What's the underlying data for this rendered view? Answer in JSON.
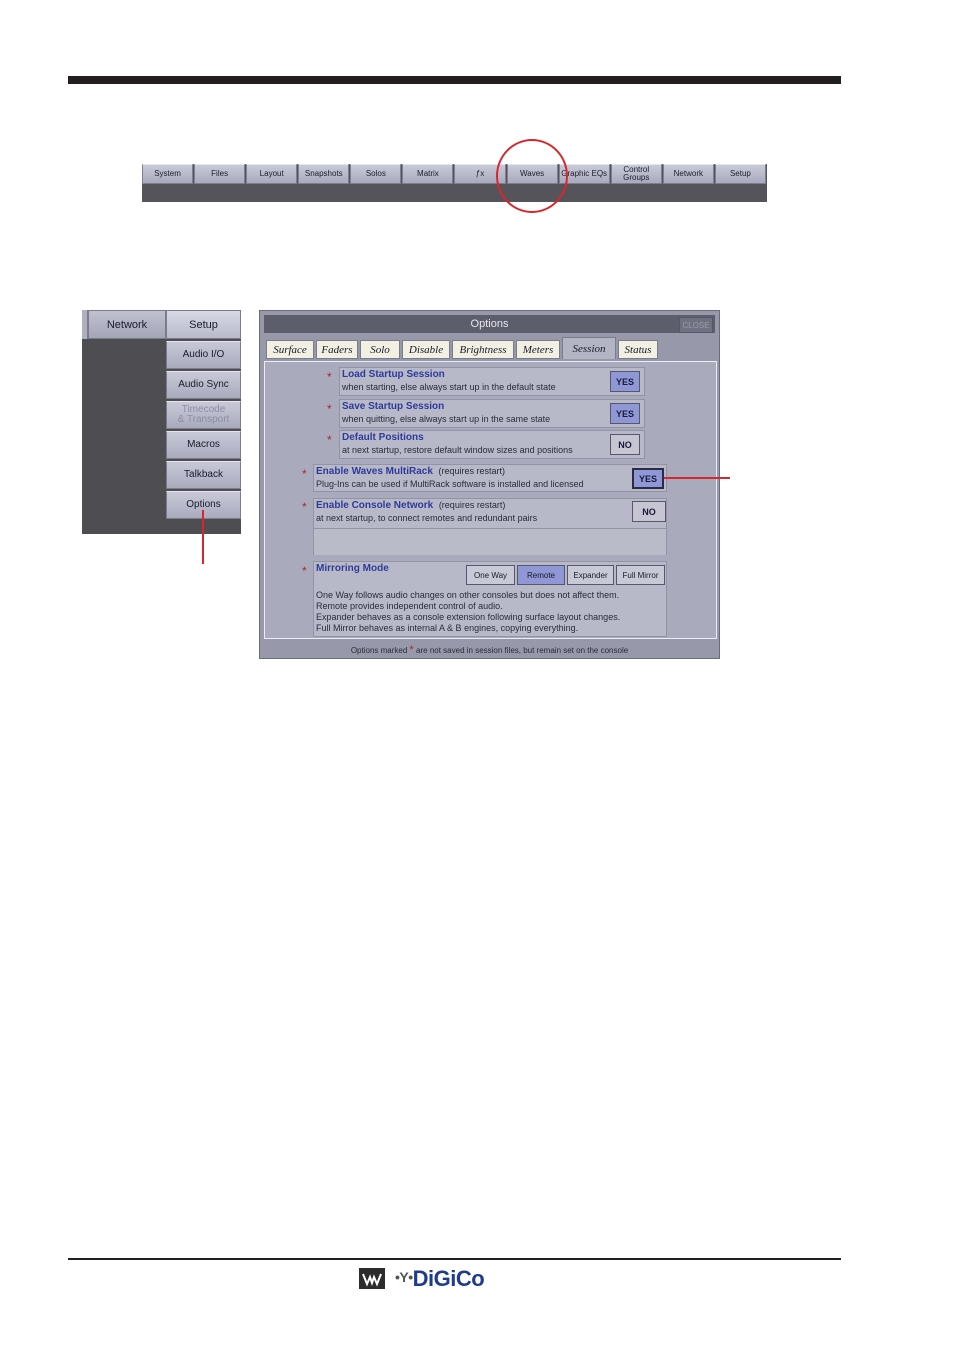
{
  "menu_bar": {
    "items": [
      "System",
      "Files",
      "Layout",
      "Snapshots",
      "Solos",
      "Matrix",
      "ƒx",
      "Waves",
      "Graphic EQs",
      "Control\nGroups",
      "Network",
      "Setup"
    ]
  },
  "setup_panel": {
    "network_label": "Network",
    "setup_label": "Setup",
    "buttons": [
      "Audio I/O",
      "Audio Sync",
      "Timecode\n& Transport",
      "Macros",
      "Talkback",
      "Options"
    ]
  },
  "options_window": {
    "title": "Options",
    "close_label": "CLOSE",
    "tabs": [
      "Surface",
      "Faders",
      "Solo",
      "Disable",
      "Brightness",
      "Meters",
      "Session",
      "Status"
    ],
    "active_tab": "Session",
    "rows": {
      "load_startup": {
        "title": "Load Startup Session",
        "subtitle": "when starting, else always start up in the default state",
        "value": "YES"
      },
      "save_startup": {
        "title": "Save Startup Session",
        "subtitle": "when quitting, else always start up in the same state",
        "value": "YES"
      },
      "default_positions": {
        "title": "Default Positions",
        "subtitle": "at next startup, restore default window sizes and positions",
        "value": "NO"
      },
      "waves_multirack": {
        "title": "Enable Waves MultiRack",
        "note": "(requires restart)",
        "subtitle": "Plug-Ins can be used if MultiRack software is installed and licensed",
        "value": "YES"
      },
      "console_network": {
        "title": "Enable Console Network",
        "note": "(requires restart)",
        "subtitle": "at next startup, to connect remotes and redundant pairs",
        "value": "NO"
      }
    },
    "mirroring": {
      "title": "Mirroring Mode",
      "buttons": [
        "One Way",
        "Remote",
        "Expander",
        "Full Mirror"
      ],
      "active": "Remote",
      "description": [
        "One Way follows audio changes on other consoles but does not affect them.",
        "Remote provides independent control of audio.",
        "Expander behaves as a console extension following surface layout changes.",
        "Full Mirror behaves as internal A & B engines, copying everything."
      ]
    },
    "footer_before": "Options marked",
    "footer_after": "are not saved in session files, but remain set on the console",
    "star": "*"
  },
  "footer_logo": {
    "brand": "DiGiCo"
  },
  "colors": {
    "accent_red": "#d8262c",
    "yes_blue": "#8f97d6",
    "title_blue": "#2e3a9a"
  }
}
